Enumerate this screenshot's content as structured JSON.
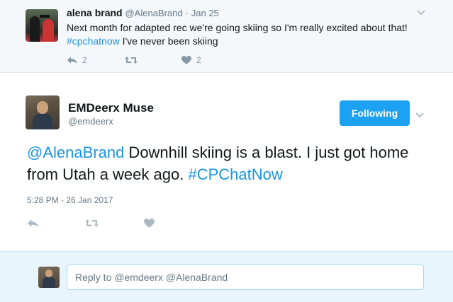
{
  "parent_tweet": {
    "name": "alena brand",
    "handle": "@AlenaBrand",
    "separator": "·",
    "date": "Jan 25",
    "text_line1": "Next month for adapted rec we're going skiing so I'm really excited about that!",
    "hashtag": "#cpchatnow",
    "text_line2_rest": " I've never been skiing",
    "reply_count": "2",
    "like_count": "2",
    "icons": [
      "reply-icon",
      "retweet-icon",
      "heart-icon",
      "chevron-down-icon"
    ]
  },
  "main_tweet": {
    "name": "EMDeerx Muse",
    "handle": "@emdeerx",
    "follow_label": "Following",
    "mention": "@AlenaBrand",
    "text_mid": " Downhill skiing is a blast. I just got home from Utah a week ago. ",
    "hashtag": "#CPChatNow",
    "timestamp": "5:28 PM - 26 Jan 2017",
    "icons": [
      "reply-icon",
      "retweet-icon",
      "heart-icon",
      "chevron-down-icon"
    ]
  },
  "reply_box": {
    "placeholder": "Reply to @emdeerx @AlenaBrand"
  },
  "colors": {
    "accent": "#1da1f2",
    "link": "#1b95e0",
    "muted": "#657786",
    "parent_bg": "#f5f8fa",
    "reply_bg": "#e8f5fd"
  }
}
